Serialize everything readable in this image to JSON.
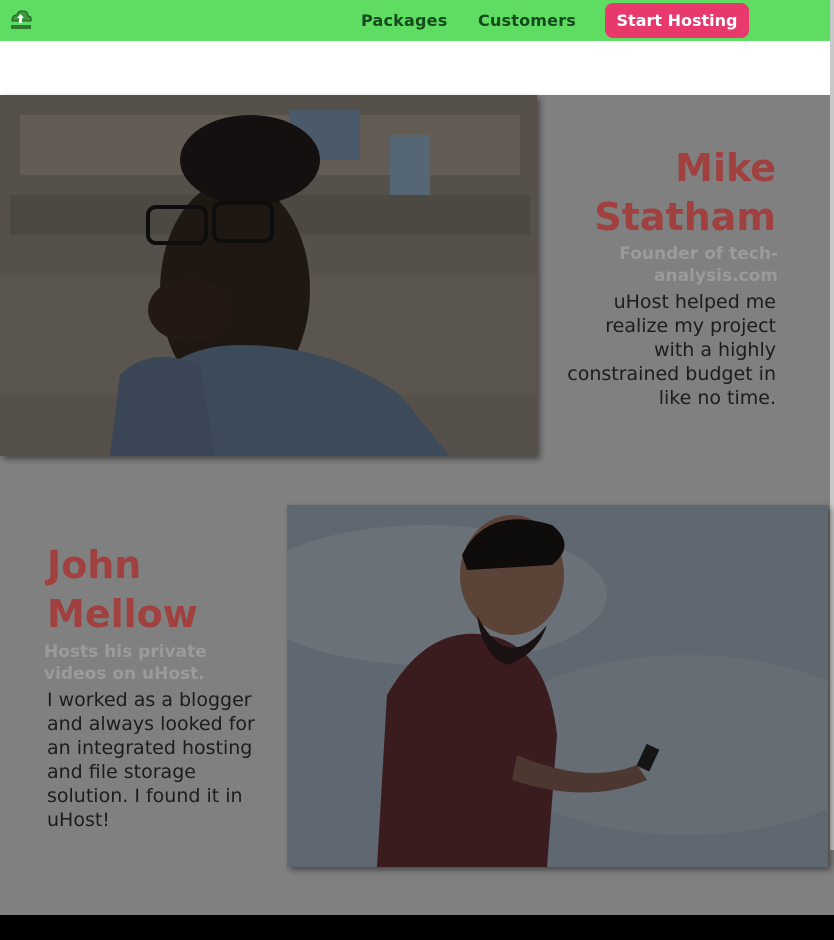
{
  "header": {
    "logo_icon": "uhost-logo-icon",
    "nav": [
      {
        "label": "Packages"
      },
      {
        "label": "Customers"
      }
    ],
    "cta_label": "Start Hosting",
    "colors": {
      "header_bg": "#5fdc62",
      "cta_bg": "#e8396c",
      "name_color": "#a0403f"
    }
  },
  "testimonials": [
    {
      "name": "Mike Statham",
      "subtitle": "Founder of tech-analysis.com",
      "quote": "uHost helped me realize my project with a highly constrained budget in like no time.",
      "photo_icon": "man-thinking-photo"
    },
    {
      "name": "John Mellow",
      "subtitle": "Hosts his private videos on uHost.",
      "quote": "I worked as a blogger and always looked for an integrated hosting and file storage solution. I found it in uHost!",
      "photo_icon": "man-with-phone-photo"
    }
  ]
}
